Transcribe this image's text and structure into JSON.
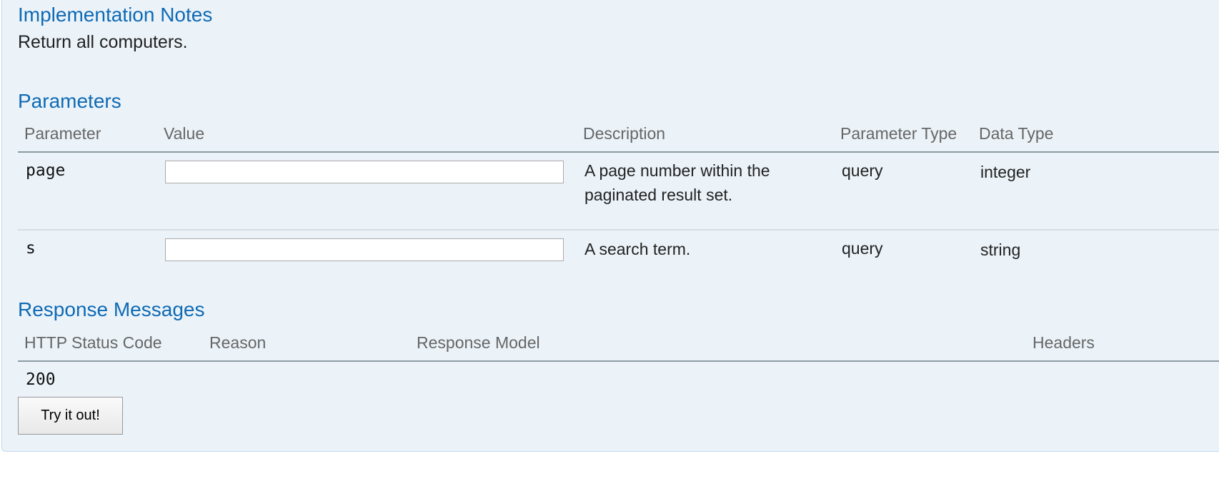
{
  "implementation_notes": {
    "heading": "Implementation Notes",
    "text": "Return all computers."
  },
  "parameters": {
    "heading": "Parameters",
    "columns": {
      "parameter": "Parameter",
      "value": "Value",
      "description": "Description",
      "parameter_type": "Parameter Type",
      "data_type": "Data Type"
    },
    "rows": [
      {
        "name": "page",
        "value": "",
        "description": "A page number within the paginated result set.",
        "parameter_type": "query",
        "data_type": "integer"
      },
      {
        "name": "s",
        "value": "",
        "description": "A search term.",
        "parameter_type": "query",
        "data_type": "string"
      }
    ]
  },
  "response_messages": {
    "heading": "Response Messages",
    "columns": {
      "status_code": "HTTP Status Code",
      "reason": "Reason",
      "response_model": "Response Model",
      "headers": "Headers"
    },
    "rows": [
      {
        "status_code": "200"
      }
    ]
  },
  "try_button": {
    "label": "Try it out!"
  },
  "colors": {
    "heading": "#0f6ab4",
    "panel_background": "#ebf3f9"
  }
}
